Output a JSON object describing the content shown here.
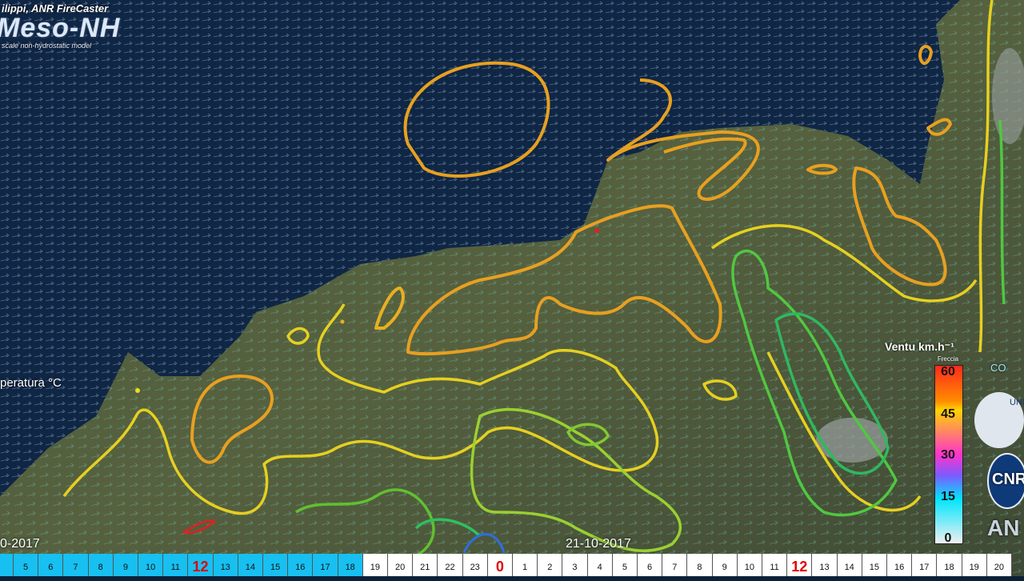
{
  "credit": "ilippi, ANR FireCaster",
  "model_logo": "Meso-NH",
  "model_logo_sub": "scale non-hydrostatic model",
  "temperature_title": "peratura °C",
  "wind_title": "Ventu km.h⁻¹",
  "wind_legend": {
    "subtitle": "Freccia",
    "ticks": [
      "60",
      "45",
      "30",
      "15",
      "0"
    ],
    "colors": [
      "#ff2a1c",
      "#ff8c00",
      "#ffd400",
      "#ff33cc",
      "#7a5cff",
      "#00e5ff",
      "#f0f0f0"
    ]
  },
  "date_left": "0-2017",
  "date_mid": "21-10-2017",
  "timeline": {
    "past_color": "#17c0f0",
    "future_color": "#ffffff",
    "highlight_color": "#e00000",
    "cells": [
      "5",
      "6",
      "7",
      "8",
      "9",
      "10",
      "11",
      "12",
      "13",
      "14",
      "15",
      "16",
      "17",
      "18",
      "19",
      "20",
      "21",
      "22",
      "23",
      "0",
      "1",
      "2",
      "3",
      "4",
      "5",
      "6",
      "7",
      "8",
      "9",
      "10",
      "11",
      "12",
      "13",
      "14",
      "15",
      "16",
      "17",
      "18",
      "19",
      "20"
    ],
    "past_count": 14,
    "highlighted": [
      "12",
      "0"
    ]
  },
  "logos": [
    "CO",
    "UNI",
    "CNR",
    "AN"
  ]
}
